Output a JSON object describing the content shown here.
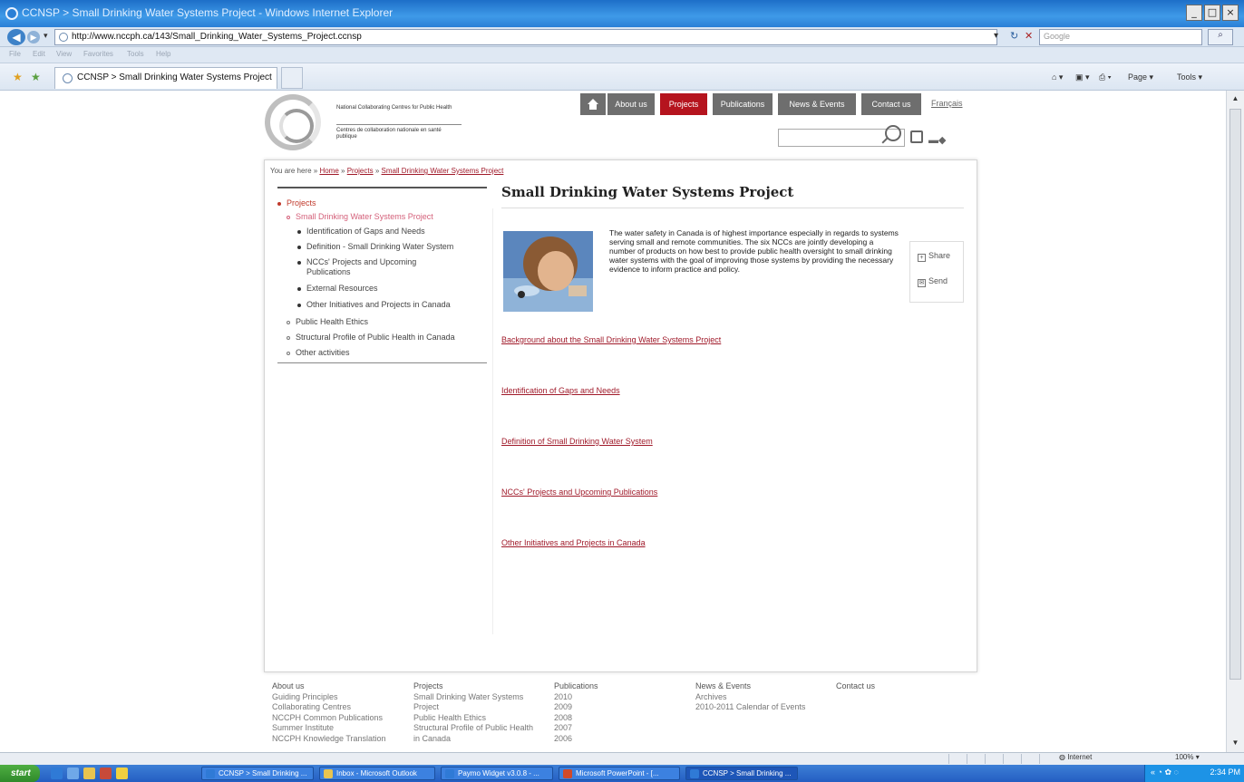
{
  "browser": {
    "title": "CCNSP > Small Drinking Water Systems Project - Windows Internet Explorer",
    "url": "http://www.nccph.ca/143/Small_Drinking_Water_Systems_Project.ccnsp",
    "search_placeholder": "Google",
    "menu": [
      "File",
      "Edit",
      "View",
      "Favorites",
      "Tools",
      "Help"
    ],
    "tab_title": "CCNSP > Small Drinking Water Systems Project",
    "commands": [
      "Page",
      "Tools"
    ],
    "status_zone": "Internet",
    "zoom": "100%"
  },
  "site": {
    "logo_en": "National Collaborating Centres for Public Health",
    "logo_fr": "Centres de collaboration nationale en santé publique",
    "nav": [
      "About us",
      "Projects",
      "Publications",
      "News & Events",
      "Contact us"
    ],
    "nav_active": "Projects",
    "francais": "Français",
    "breadcrumb": {
      "prefix": "You are here »",
      "home": "Home",
      "sep": "»",
      "projects": "Projects",
      "current": "Small Drinking Water Systems Project"
    },
    "sidenav": {
      "projects": "Projects",
      "sdws": "Small Drinking Water Systems Project",
      "sub": [
        "Identification of Gaps and Needs",
        "Definition - Small Drinking Water System",
        "NCCs' Projects and Upcoming",
        "Publications",
        "External Resources",
        "Other Initiatives and Projects in Canada"
      ],
      "others": [
        "Public Health Ethics",
        "Structural Profile of Public Health in Canada",
        "Other activities"
      ]
    },
    "heading": "Small Drinking Water Systems Project",
    "intro": "The water safety in Canada is of highest importance especially in regards to systems serving small and remote communities. The six NCCs are jointly developing a number of products on how best to provide public health oversight to small drinking water systems with the goal of improving those systems by providing the necessary evidence to inform practice and policy.",
    "share": "Share",
    "send": "Send",
    "links": [
      "Background about the Small Drinking Water Systems Project",
      "Identification of Gaps and Needs",
      "Definition of Small Drinking Water System",
      "NCCs' Projects and Upcoming Publications",
      "Other Initiatives and Projects in Canada"
    ],
    "footer": {
      "about": {
        "title": "About us",
        "items": [
          "Guiding Principles",
          "Collaborating Centres",
          "NCCPH Common Publications",
          "Summer Institute",
          "NCCPH Knowledge Translation"
        ]
      },
      "projects": {
        "title": "Projects",
        "items": [
          "Small Drinking Water Systems",
          "Project",
          "Public Health Ethics",
          "Structural Profile of Public Health",
          "in Canada"
        ]
      },
      "publications": {
        "title": "Publications",
        "items": [
          "2010",
          "2009",
          "2008",
          "2007",
          "2006"
        ]
      },
      "news": {
        "title": "News & Events",
        "items": [
          "Archives",
          "2010-2011 Calendar of Events"
        ]
      },
      "contact": {
        "title": "Contact us"
      }
    }
  },
  "taskbar": {
    "start": "start",
    "buttons": [
      "CCNSP > Small Drinking ...",
      "Inbox - Microsoft Outlook",
      "Paymo Widget v3.0.8 - ...",
      "Microsoft PowerPoint - [...",
      "CCNSP > Small Drinking ..."
    ],
    "time": "2:34 PM"
  },
  "colors": {
    "accent": "#b5141e",
    "link": "#a01a2a",
    "nav_gray": "#6e6e6e",
    "titlebar": "#2a7fd6"
  }
}
